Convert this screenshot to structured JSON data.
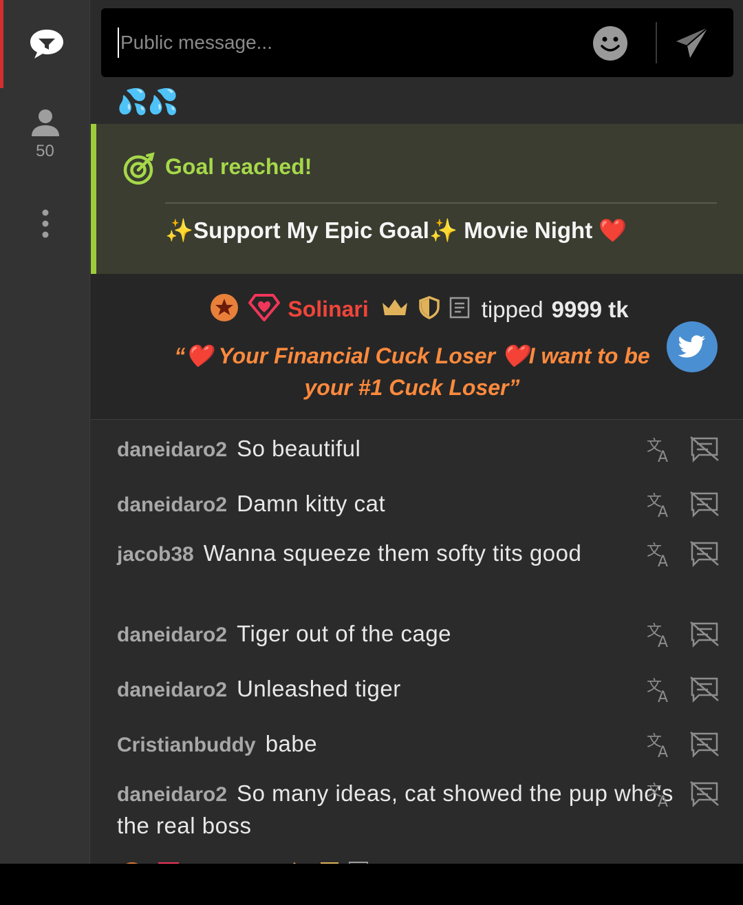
{
  "sidebar": {
    "user_count": "50"
  },
  "composer": {
    "placeholder": "Public message..."
  },
  "feed": {
    "emoji_row": "💦💦",
    "goal": {
      "title": "Goal reached!",
      "text": "✨Support My Epic Goal✨ Movie Night ❤️"
    },
    "tip": {
      "username": "Solinari",
      "verb": "tipped",
      "amount": "9999 tk",
      "message": "“❤️ Your Financial Cuck Loser ❤️I want to be your #1 Cuck Loser”"
    },
    "messages": [
      {
        "user": "daneidaro2",
        "text": "So beautiful"
      },
      {
        "user": "daneidaro2",
        "text": "Damn kitty cat"
      },
      {
        "user": "jacob38",
        "text": "Wanna squeeze them softy tits good"
      },
      {
        "user": "daneidaro2",
        "text": "Tiger out of the cage"
      },
      {
        "user": "daneidaro2",
        "text": "Unleashed tiger"
      },
      {
        "user": "Cristianbuddy",
        "text": "babe"
      },
      {
        "user": "daneidaro2",
        "text": "So many ideas, cat showed the pup who's the real boss"
      }
    ]
  },
  "colors": {
    "accent_red": "#d32f2f",
    "goal_green": "#9ccc3a",
    "tip_orange": "#ff8a3d",
    "username_red": "#f0453a",
    "twitter_blue": "#4a8fd1"
  },
  "icons": {
    "chat": "chat-bubble-icon",
    "users": "person-icon",
    "more": "more-vertical-icon",
    "emoji": "smiley-icon",
    "send": "send-icon",
    "goal": "target-icon",
    "translate": "translate-icon",
    "block": "comment-off-icon",
    "twitter": "twitter-icon"
  }
}
